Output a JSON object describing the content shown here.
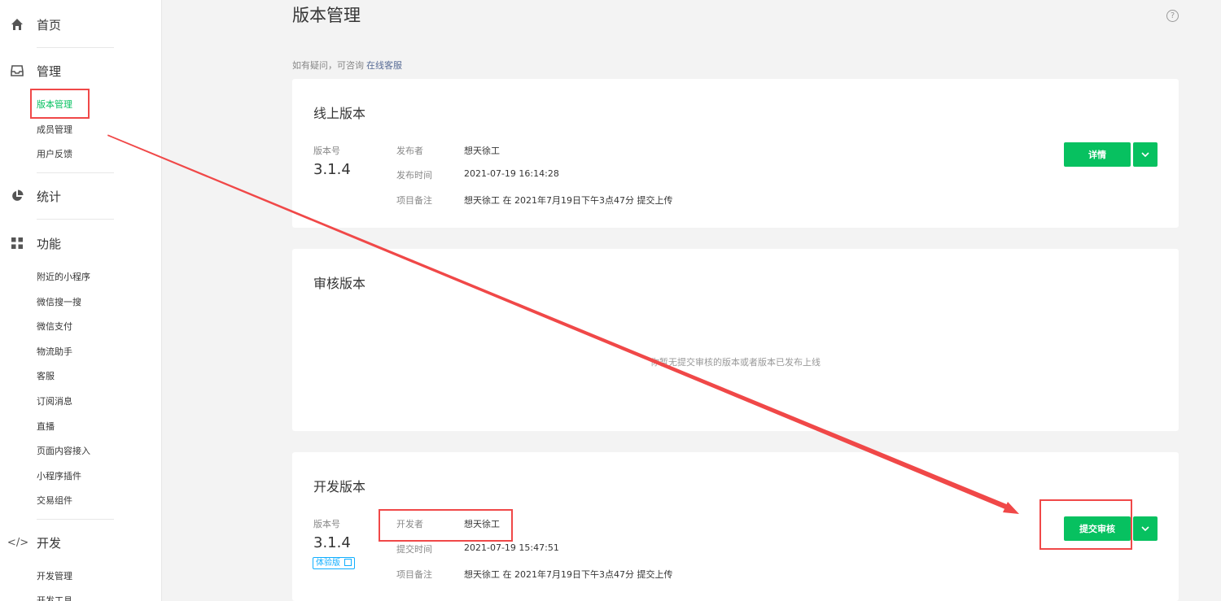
{
  "sidebar": {
    "home": "首页",
    "manage": "管理",
    "manage_items": [
      "版本管理",
      "成员管理",
      "用户反馈"
    ],
    "stats": "统计",
    "features": "功能",
    "feature_items": [
      "附近的小程序",
      "微信搜一搜",
      "微信支付",
      "物流助手",
      "客服",
      "订阅消息",
      "直播",
      "页面内容接入",
      "小程序插件",
      "交易组件"
    ],
    "dev": "开发",
    "dev_items": [
      "开发管理",
      "开发工具"
    ]
  },
  "page": {
    "title": "版本管理",
    "help": "?",
    "consult_text": "如有疑问，可咨询",
    "consult_link": "在线客服"
  },
  "online": {
    "title": "线上版本",
    "version_label": "版本号",
    "version": "3.1.4",
    "publisher_label": "发布者",
    "publisher": "想天徐工",
    "time_label": "发布时间",
    "time": "2021-07-19 16:14:28",
    "note_label": "项目备注",
    "note": "想天徐工 在 2021年7月19日下午3点47分 提交上传",
    "detail_button": "详情"
  },
  "review": {
    "title": "审核版本",
    "empty": "你暂无提交审核的版本或者版本已发布上线"
  },
  "dev": {
    "title": "开发版本",
    "version_label": "版本号",
    "version": "3.1.4",
    "badge": "体验版",
    "developer_label": "开发者",
    "developer": "想天徐工",
    "time_label": "提交时间",
    "time": "2021-07-19 15:47:51",
    "note_label": "项目备注",
    "note": "想天徐工 在 2021年7月19日下午3点47分 提交上传",
    "submit_button": "提交审核"
  },
  "colors": {
    "accent": "#07c160",
    "annotation": "#f04848",
    "link": "#576b95",
    "badge": "#10aeff"
  }
}
